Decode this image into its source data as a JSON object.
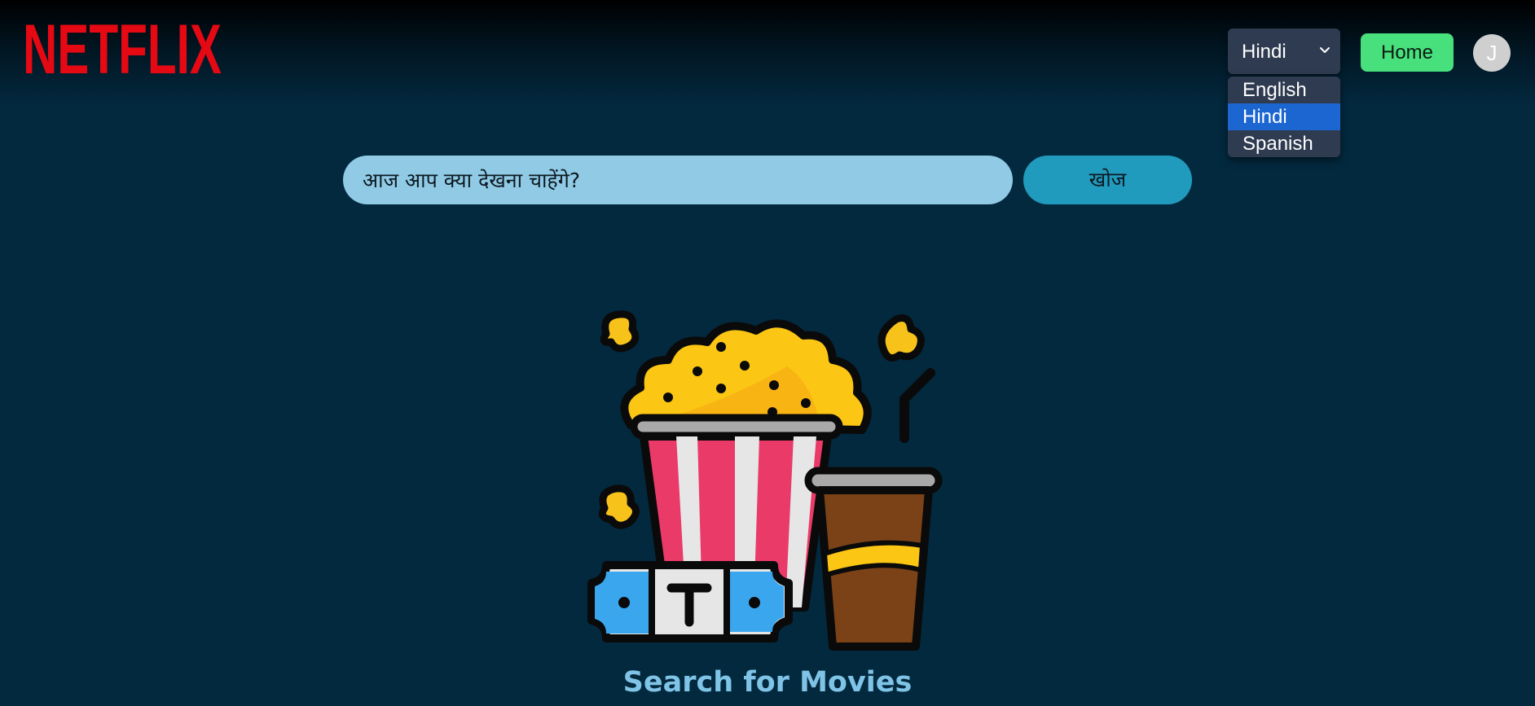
{
  "header": {
    "logo_text": "NETFLIX",
    "language_select": {
      "selected": "Hindi",
      "options": [
        "English",
        "Hindi",
        "Spanish"
      ]
    },
    "home_label": "Home",
    "avatar_initial": "J"
  },
  "search": {
    "placeholder": "आज आप क्या देखना चाहेंगे?",
    "button_label": "खोज"
  },
  "empty_state": {
    "title": "Search for Movies",
    "illustration": "popcorn-drink-ticket-illustration"
  },
  "colors": {
    "background": "#03293f",
    "logo": "#e50914",
    "home_button": "#47e07c",
    "search_input": "#90cae5",
    "search_button": "#209bbd",
    "dropdown_active": "#1c66d2",
    "title": "#7fc3e6"
  }
}
